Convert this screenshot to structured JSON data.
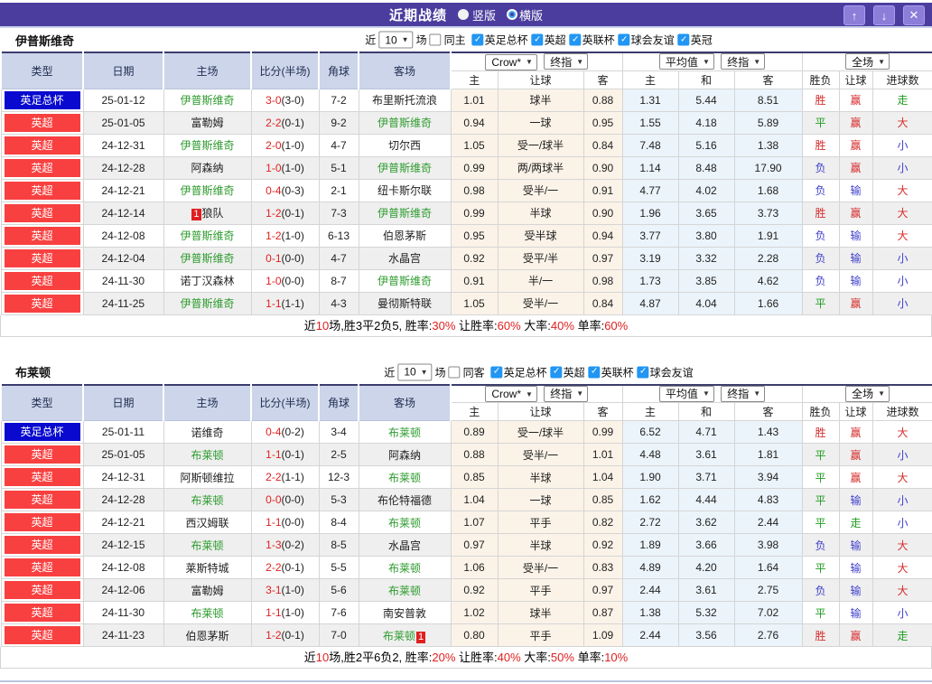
{
  "titlebar": {
    "title": "近期战绩",
    "vertical_label": "竖版",
    "horizontal_label": "横版",
    "icons": {
      "up": "↑",
      "down": "↓",
      "close": "✕",
      "check": "✓",
      "chevron": "▼"
    }
  },
  "colors": {
    "titlebar_purple": "#4b3d9e",
    "league_red": "#f84040",
    "league_blue": "#0909cf",
    "team_green": "#2e9b2e",
    "score_red": "#e02020",
    "win_red": "#d62c2c",
    "draw_green": "#1f9c1f",
    "lose_blue": "#4040cc",
    "checkbox_blue": "#2196f3",
    "header_bg": "#cdd5ea",
    "odds_bg": "#fbf3e8",
    "avg_bg": "#ebf4fb"
  },
  "table_header": {
    "type": "类型",
    "date": "日期",
    "home": "主场",
    "score": "比分(半场)",
    "corner": "角球",
    "away": "客场",
    "odds_home": "主",
    "odds_handicap": "让球",
    "odds_away": "客",
    "avg_home": "主",
    "avg_draw": "和",
    "avg_away": "客",
    "result_outcome": "胜负",
    "result_handicap": "让球",
    "result_goals": "进球数",
    "bookmaker_select": "Crow*",
    "final_odds_select_1": "终指",
    "average_select": "平均值",
    "final_odds_select_2": "终指",
    "full_match_select": "全场"
  },
  "sections": [
    {
      "team": "伊普斯维奇",
      "filter": {
        "near_label": "近",
        "games_count": "10",
        "games_label": "场",
        "same_venue_checked": false,
        "same_venue_label": "同主",
        "leagues": [
          "英足总杯",
          "英超",
          "英联杯",
          "球会友谊",
          "英冠"
        ]
      },
      "rows": [
        {
          "league": "英足总杯",
          "lcolor": "blue",
          "date": "25-01-12",
          "home": "伊普斯维奇",
          "homeTeam": true,
          "homeBadge": "",
          "score": "3-0",
          "half": "(3-0)",
          "corners": "7-2",
          "away": "布里斯托流浪",
          "awayTeam": false,
          "awayBadge": "",
          "oddsH": "1.01",
          "handicap": "球半",
          "oddsA": "0.88",
          "avgH": "1.31",
          "avgD": "5.44",
          "avgA": "8.51",
          "resW": "胜",
          "resWc": "r",
          "resH": "赢",
          "resHc": "r",
          "resG": "走",
          "resGc": "g"
        },
        {
          "league": "英超",
          "lcolor": "red",
          "date": "25-01-05",
          "home": "富勒姆",
          "homeTeam": false,
          "homeBadge": "",
          "score": "2-2",
          "half": "(0-1)",
          "corners": "9-2",
          "away": "伊普斯维奇",
          "awayTeam": true,
          "awayBadge": "",
          "oddsH": "0.94",
          "handicap": "一球",
          "oddsA": "0.95",
          "avgH": "1.55",
          "avgD": "4.18",
          "avgA": "5.89",
          "resW": "平",
          "resWc": "g",
          "resH": "赢",
          "resHc": "r",
          "resG": "大",
          "resGc": "r"
        },
        {
          "league": "英超",
          "lcolor": "red",
          "date": "24-12-31",
          "home": "伊普斯维奇",
          "homeTeam": true,
          "homeBadge": "",
          "score": "2-0",
          "half": "(1-0)",
          "corners": "4-7",
          "away": "切尔西",
          "awayTeam": false,
          "awayBadge": "",
          "oddsH": "1.05",
          "handicap": "受一/球半",
          "oddsA": "0.84",
          "avgH": "7.48",
          "avgD": "5.16",
          "avgA": "1.38",
          "resW": "胜",
          "resWc": "r",
          "resH": "赢",
          "resHc": "r",
          "resG": "小",
          "resGc": "b"
        },
        {
          "league": "英超",
          "lcolor": "red",
          "date": "24-12-28",
          "home": "阿森纳",
          "homeTeam": false,
          "homeBadge": "",
          "score": "1-0",
          "half": "(1-0)",
          "corners": "5-1",
          "away": "伊普斯维奇",
          "awayTeam": true,
          "awayBadge": "",
          "oddsH": "0.99",
          "handicap": "两/两球半",
          "oddsA": "0.90",
          "avgH": "1.14",
          "avgD": "8.48",
          "avgA": "17.90",
          "resW": "负",
          "resWc": "b",
          "resH": "赢",
          "resHc": "r",
          "resG": "小",
          "resGc": "b"
        },
        {
          "league": "英超",
          "lcolor": "red",
          "date": "24-12-21",
          "home": "伊普斯维奇",
          "homeTeam": true,
          "homeBadge": "",
          "score": "0-4",
          "half": "(0-3)",
          "corners": "2-1",
          "away": "纽卡斯尔联",
          "awayTeam": false,
          "awayBadge": "",
          "oddsH": "0.98",
          "handicap": "受半/一",
          "oddsA": "0.91",
          "avgH": "4.77",
          "avgD": "4.02",
          "avgA": "1.68",
          "resW": "负",
          "resWc": "b",
          "resH": "输",
          "resHc": "b",
          "resG": "大",
          "resGc": "r"
        },
        {
          "league": "英超",
          "lcolor": "red",
          "date": "24-12-14",
          "home": "狼队",
          "homeTeam": false,
          "homeBadge": "1",
          "score": "1-2",
          "half": "(0-1)",
          "corners": "7-3",
          "away": "伊普斯维奇",
          "awayTeam": true,
          "awayBadge": "",
          "oddsH": "0.99",
          "handicap": "半球",
          "oddsA": "0.90",
          "avgH": "1.96",
          "avgD": "3.65",
          "avgA": "3.73",
          "resW": "胜",
          "resWc": "r",
          "resH": "赢",
          "resHc": "r",
          "resG": "大",
          "resGc": "r"
        },
        {
          "league": "英超",
          "lcolor": "red",
          "date": "24-12-08",
          "home": "伊普斯维奇",
          "homeTeam": true,
          "homeBadge": "",
          "score": "1-2",
          "half": "(1-0)",
          "corners": "6-13",
          "away": "伯恩茅斯",
          "awayTeam": false,
          "awayBadge": "",
          "oddsH": "0.95",
          "handicap": "受半球",
          "oddsA": "0.94",
          "avgH": "3.77",
          "avgD": "3.80",
          "avgA": "1.91",
          "resW": "负",
          "resWc": "b",
          "resH": "输",
          "resHc": "b",
          "resG": "大",
          "resGc": "r"
        },
        {
          "league": "英超",
          "lcolor": "red",
          "date": "24-12-04",
          "home": "伊普斯维奇",
          "homeTeam": true,
          "homeBadge": "",
          "score": "0-1",
          "half": "(0-0)",
          "corners": "4-7",
          "away": "水晶宫",
          "awayTeam": false,
          "awayBadge": "",
          "oddsH": "0.92",
          "handicap": "受平/半",
          "oddsA": "0.97",
          "avgH": "3.19",
          "avgD": "3.32",
          "avgA": "2.28",
          "resW": "负",
          "resWc": "b",
          "resH": "输",
          "resHc": "b",
          "resG": "小",
          "resGc": "b"
        },
        {
          "league": "英超",
          "lcolor": "red",
          "date": "24-11-30",
          "home": "诺丁汉森林",
          "homeTeam": false,
          "homeBadge": "",
          "score": "1-0",
          "half": "(0-0)",
          "corners": "8-7",
          "away": "伊普斯维奇",
          "awayTeam": true,
          "awayBadge": "",
          "oddsH": "0.91",
          "handicap": "半/一",
          "oddsA": "0.98",
          "avgH": "1.73",
          "avgD": "3.85",
          "avgA": "4.62",
          "resW": "负",
          "resWc": "b",
          "resH": "输",
          "resHc": "b",
          "resG": "小",
          "resGc": "b"
        },
        {
          "league": "英超",
          "lcolor": "red",
          "date": "24-11-25",
          "home": "伊普斯维奇",
          "homeTeam": true,
          "homeBadge": "",
          "score": "1-1",
          "half": "(1-1)",
          "corners": "4-3",
          "away": "曼彻斯特联",
          "awayTeam": false,
          "awayBadge": "",
          "oddsH": "1.05",
          "handicap": "受半/一",
          "oddsA": "0.84",
          "avgH": "4.87",
          "avgD": "4.04",
          "avgA": "1.66",
          "resW": "平",
          "resWc": "g",
          "resH": "赢",
          "resHc": "r",
          "resG": "小",
          "resGc": "b"
        }
      ],
      "summary": [
        [
          "近",
          "k"
        ],
        [
          "10",
          "r"
        ],
        [
          "场,胜3平2负5, 胜率:",
          "k"
        ],
        [
          "30%",
          "r"
        ],
        [
          " 让胜率:",
          "k"
        ],
        [
          "60%",
          "r"
        ],
        [
          " 大率:",
          "k"
        ],
        [
          "40%",
          "r"
        ],
        [
          " 单率:",
          "k"
        ],
        [
          "60%",
          "r"
        ]
      ]
    },
    {
      "team": "布莱顿",
      "filter": {
        "near_label": "近",
        "games_count": "10",
        "games_label": "场",
        "same_venue_checked": false,
        "same_venue_label": "同客",
        "leagues": [
          "英足总杯",
          "英超",
          "英联杯",
          "球会友谊"
        ]
      },
      "rows": [
        {
          "league": "英足总杯",
          "lcolor": "blue",
          "date": "25-01-11",
          "home": "诺维奇",
          "homeTeam": false,
          "homeBadge": "",
          "score": "0-4",
          "half": "(0-2)",
          "corners": "3-4",
          "away": "布莱顿",
          "awayTeam": true,
          "awayBadge": "",
          "oddsH": "0.89",
          "handicap": "受一/球半",
          "oddsA": "0.99",
          "avgH": "6.52",
          "avgD": "4.71",
          "avgA": "1.43",
          "resW": "胜",
          "resWc": "r",
          "resH": "赢",
          "resHc": "r",
          "resG": "大",
          "resGc": "r"
        },
        {
          "league": "英超",
          "lcolor": "red",
          "date": "25-01-05",
          "home": "布莱顿",
          "homeTeam": true,
          "homeBadge": "",
          "score": "1-1",
          "half": "(0-1)",
          "corners": "2-5",
          "away": "阿森纳",
          "awayTeam": false,
          "awayBadge": "",
          "oddsH": "0.88",
          "handicap": "受半/一",
          "oddsA": "1.01",
          "avgH": "4.48",
          "avgD": "3.61",
          "avgA": "1.81",
          "resW": "平",
          "resWc": "g",
          "resH": "赢",
          "resHc": "r",
          "resG": "小",
          "resGc": "b"
        },
        {
          "league": "英超",
          "lcolor": "red",
          "date": "24-12-31",
          "home": "阿斯顿维拉",
          "homeTeam": false,
          "homeBadge": "",
          "score": "2-2",
          "half": "(1-1)",
          "corners": "12-3",
          "away": "布莱顿",
          "awayTeam": true,
          "awayBadge": "",
          "oddsH": "0.85",
          "handicap": "半球",
          "oddsA": "1.04",
          "avgH": "1.90",
          "avgD": "3.71",
          "avgA": "3.94",
          "resW": "平",
          "resWc": "g",
          "resH": "赢",
          "resHc": "r",
          "resG": "大",
          "resGc": "r"
        },
        {
          "league": "英超",
          "lcolor": "red",
          "date": "24-12-28",
          "home": "布莱顿",
          "homeTeam": true,
          "homeBadge": "",
          "score": "0-0",
          "half": "(0-0)",
          "corners": "5-3",
          "away": "布伦特福德",
          "awayTeam": false,
          "awayBadge": "",
          "oddsH": "1.04",
          "handicap": "一球",
          "oddsA": "0.85",
          "avgH": "1.62",
          "avgD": "4.44",
          "avgA": "4.83",
          "resW": "平",
          "resWc": "g",
          "resH": "输",
          "resHc": "b",
          "resG": "小",
          "resGc": "b"
        },
        {
          "league": "英超",
          "lcolor": "red",
          "date": "24-12-21",
          "home": "西汉姆联",
          "homeTeam": false,
          "homeBadge": "",
          "score": "1-1",
          "half": "(0-0)",
          "corners": "8-4",
          "away": "布莱顿",
          "awayTeam": true,
          "awayBadge": "",
          "oddsH": "1.07",
          "handicap": "平手",
          "oddsA": "0.82",
          "avgH": "2.72",
          "avgD": "3.62",
          "avgA": "2.44",
          "resW": "平",
          "resWc": "g",
          "resH": "走",
          "resHc": "g",
          "resG": "小",
          "resGc": "b"
        },
        {
          "league": "英超",
          "lcolor": "red",
          "date": "24-12-15",
          "home": "布莱顿",
          "homeTeam": true,
          "homeBadge": "",
          "score": "1-3",
          "half": "(0-2)",
          "corners": "8-5",
          "away": "水晶宫",
          "awayTeam": false,
          "awayBadge": "",
          "oddsH": "0.97",
          "handicap": "半球",
          "oddsA": "0.92",
          "avgH": "1.89",
          "avgD": "3.66",
          "avgA": "3.98",
          "resW": "负",
          "resWc": "b",
          "resH": "输",
          "resHc": "b",
          "resG": "大",
          "resGc": "r"
        },
        {
          "league": "英超",
          "lcolor": "red",
          "date": "24-12-08",
          "home": "莱斯特城",
          "homeTeam": false,
          "homeBadge": "",
          "score": "2-2",
          "half": "(0-1)",
          "corners": "5-5",
          "away": "布莱顿",
          "awayTeam": true,
          "awayBadge": "",
          "oddsH": "1.06",
          "handicap": "受半/一",
          "oddsA": "0.83",
          "avgH": "4.89",
          "avgD": "4.20",
          "avgA": "1.64",
          "resW": "平",
          "resWc": "g",
          "resH": "输",
          "resHc": "b",
          "resG": "大",
          "resGc": "r"
        },
        {
          "league": "英超",
          "lcolor": "red",
          "date": "24-12-06",
          "home": "富勒姆",
          "homeTeam": false,
          "homeBadge": "",
          "score": "3-1",
          "half": "(1-0)",
          "corners": "5-6",
          "away": "布莱顿",
          "awayTeam": true,
          "awayBadge": "",
          "oddsH": "0.92",
          "handicap": "平手",
          "oddsA": "0.97",
          "avgH": "2.44",
          "avgD": "3.61",
          "avgA": "2.75",
          "resW": "负",
          "resWc": "b",
          "resH": "输",
          "resHc": "b",
          "resG": "大",
          "resGc": "r"
        },
        {
          "league": "英超",
          "lcolor": "red",
          "date": "24-11-30",
          "home": "布莱顿",
          "homeTeam": true,
          "homeBadge": "",
          "score": "1-1",
          "half": "(1-0)",
          "corners": "7-6",
          "away": "南安普敦",
          "awayTeam": false,
          "awayBadge": "",
          "oddsH": "1.02",
          "handicap": "球半",
          "oddsA": "0.87",
          "avgH": "1.38",
          "avgD": "5.32",
          "avgA": "7.02",
          "resW": "平",
          "resWc": "g",
          "resH": "输",
          "resHc": "b",
          "resG": "小",
          "resGc": "b"
        },
        {
          "league": "英超",
          "lcolor": "red",
          "date": "24-11-23",
          "home": "伯恩茅斯",
          "homeTeam": false,
          "homeBadge": "",
          "score": "1-2",
          "half": "(0-1)",
          "corners": "7-0",
          "away": "布莱顿",
          "awayTeam": true,
          "awayBadge": "1",
          "oddsH": "0.80",
          "handicap": "平手",
          "oddsA": "1.09",
          "avgH": "2.44",
          "avgD": "3.56",
          "avgA": "2.76",
          "resW": "胜",
          "resWc": "r",
          "resH": "赢",
          "resHc": "r",
          "resG": "走",
          "resGc": "g"
        }
      ],
      "summary": [
        [
          "近",
          "k"
        ],
        [
          "10",
          "r"
        ],
        [
          "场,胜2平6负2, 胜率:",
          "k"
        ],
        [
          "20%",
          "r"
        ],
        [
          " 让胜率:",
          "k"
        ],
        [
          "40%",
          "r"
        ],
        [
          " 大率:",
          "k"
        ],
        [
          "50%",
          "r"
        ],
        [
          " 单率:",
          "k"
        ],
        [
          "10%",
          "r"
        ]
      ]
    }
  ]
}
